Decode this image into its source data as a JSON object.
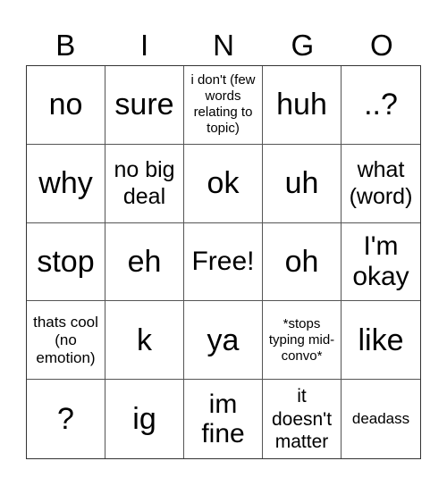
{
  "header": {
    "letters": [
      "B",
      "I",
      "N",
      "G",
      "O"
    ]
  },
  "grid": {
    "rows": [
      [
        "no",
        "sure",
        "i don't (few words relating to topic)",
        "huh",
        "..?"
      ],
      [
        "why",
        "no big deal",
        "ok",
        "uh",
        "what (word)"
      ],
      [
        "stop",
        "eh",
        "Free!",
        "oh",
        "I'm okay"
      ],
      [
        "thats cool (no emotion)",
        "k",
        "ya",
        "*stops typing mid-convo*",
        "like"
      ],
      [
        "?",
        "ig",
        "im fine",
        "it doesn't matter",
        "deadass"
      ]
    ]
  }
}
